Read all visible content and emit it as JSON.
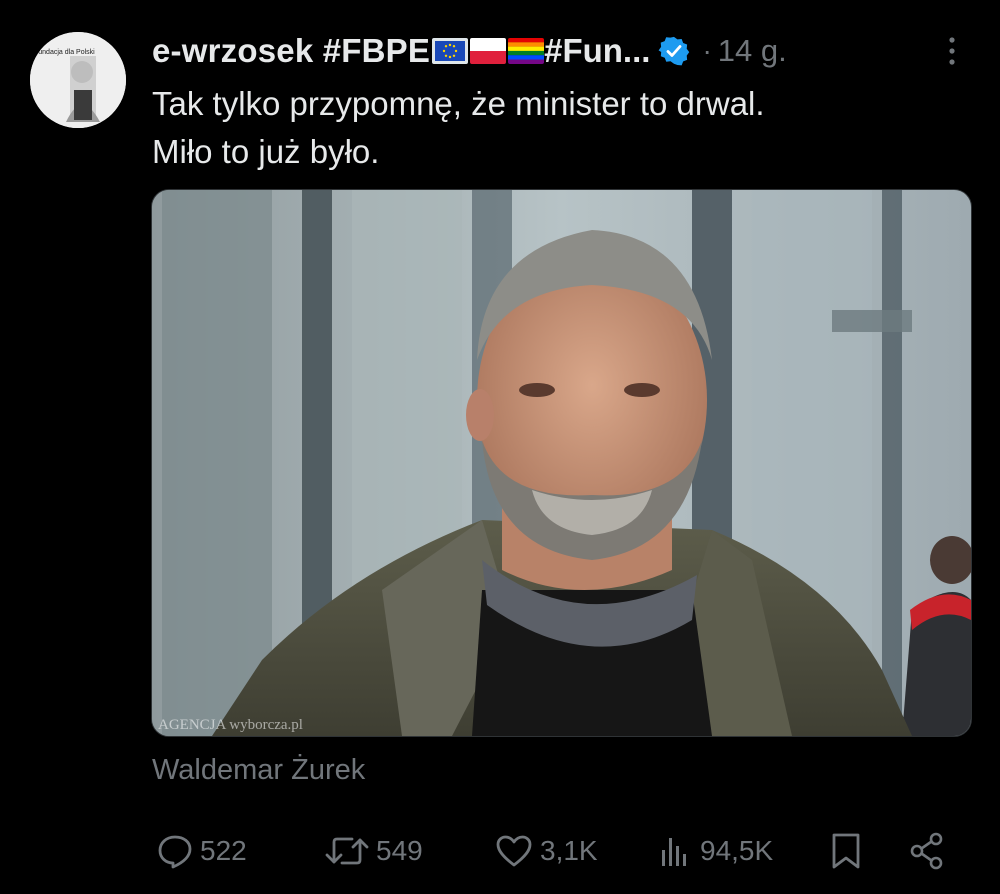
{
  "tweet": {
    "author": {
      "display_name": "e-wrzosek #FBPE",
      "display_name_tail": "#Fun...",
      "avatar_text": "Fundacja dla Polski",
      "avatar_icon": "profile-avatar",
      "verified_icon": "verified-badge-icon"
    },
    "time_sep": "·",
    "time": "14 g.",
    "text_lines": [
      "Tak tylko przypomnę, że minister to drwal.",
      "Miło to już było."
    ],
    "media": {
      "watermark": "AGENCJA wyborcza.pl"
    },
    "caption": "Waldemar Żurek",
    "actions": {
      "replies": "522",
      "reposts": "549",
      "likes": "3,1K",
      "views": "94,5K"
    }
  },
  "colors": {
    "background": "#000000",
    "text_primary": "#e7e9ea",
    "text_secondary": "#71767b",
    "verified": "#1d9bf0"
  }
}
